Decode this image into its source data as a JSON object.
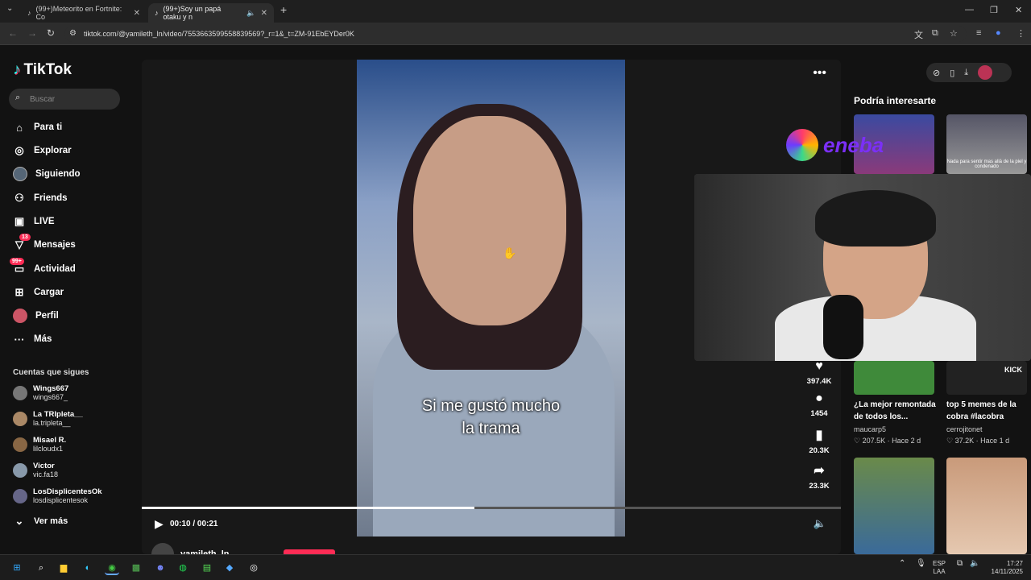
{
  "browser": {
    "tabs": [
      {
        "title": "(99+)Meteorito en Fortnite: Co"
      },
      {
        "title": "(99+)Soy un papá otaku y n"
      }
    ],
    "url": "tiktok.com/@yamileth_ln/video/7553663599558839569?_r=1&_t=ZM-91EbEYDer0K"
  },
  "sidebar": {
    "logo": "TikTok",
    "search_placeholder": "Buscar",
    "nav": [
      {
        "label": "Para ti",
        "icon": "home-icon"
      },
      {
        "label": "Explorar",
        "icon": "compass-icon"
      },
      {
        "label": "Siguiendo",
        "icon": "following-avatar-icon"
      },
      {
        "label": "Friends",
        "icon": "friends-icon"
      },
      {
        "label": "LIVE",
        "icon": "live-icon"
      },
      {
        "label": "Mensajes",
        "icon": "messages-icon",
        "badge": "13"
      },
      {
        "label": "Actividad",
        "icon": "activity-icon",
        "badge": "99+"
      },
      {
        "label": "Cargar",
        "icon": "upload-icon"
      },
      {
        "label": "Perfil",
        "icon": "profile-icon"
      },
      {
        "label": "Más",
        "icon": "more-icon"
      }
    ],
    "following_title": "Cuentas que sigues",
    "following": [
      {
        "name": "Wings667",
        "handle": "wings667_"
      },
      {
        "name": "La TRIpleta__",
        "handle": "la.tripleta__"
      },
      {
        "name": "Misael R.",
        "handle": "lilcloudx1"
      },
      {
        "name": "Victor",
        "handle": "vic.fa18"
      },
      {
        "name": "LosDisplicentesOk",
        "handle": "losdisplicentesok"
      }
    ],
    "see_more": "Ver más"
  },
  "video": {
    "caption_line1": "Si me gustó mucho",
    "caption_line2": "la trama",
    "time": "00:10 / 00:21",
    "progress": 0.476,
    "author": "yamileth_ln",
    "actions": [
      {
        "icon": "heart-icon",
        "count": "397.4K"
      },
      {
        "icon": "comment-icon",
        "count": "1454"
      },
      {
        "icon": "bookmark-icon",
        "count": "20.3K"
      },
      {
        "icon": "share-icon",
        "count": "23.3K"
      }
    ]
  },
  "recommended": {
    "title": "Podría interesarte",
    "items": [
      {
        "caption": "¿La mejor remontada de todos los...",
        "author": "maucarp5",
        "likes": "207.5K",
        "age": "Hace 2 d"
      },
      {
        "caption": "top 5 memes de la cobra #lacobra",
        "author": "cerrojitonet",
        "likes": "37.2K",
        "age": "Hace 1 d"
      }
    ],
    "thumb_text_2": "Nada para sentir mas allá de la piel y condenado",
    "thumb_text_4": "KICK"
  },
  "overlay": {
    "brand": "eneba"
  },
  "taskbar": {
    "lang": "ESP",
    "layout": "LAA",
    "time": "17:27",
    "date": "14/11/2025"
  }
}
